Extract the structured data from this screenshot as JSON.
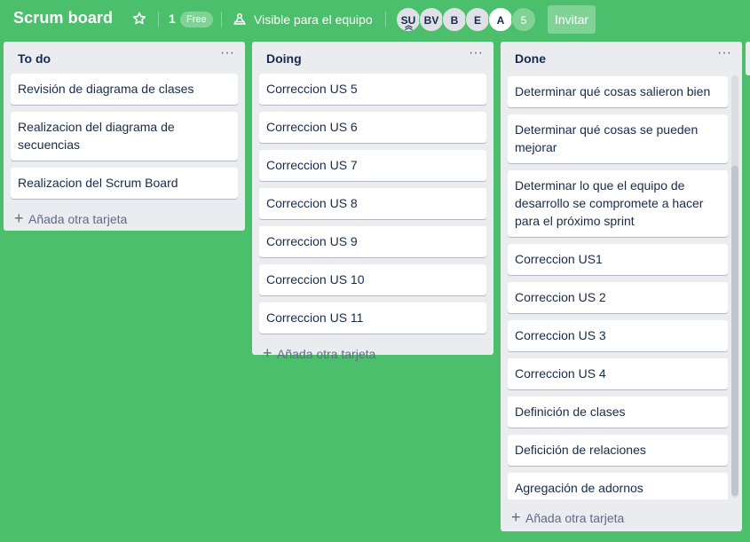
{
  "board": {
    "title": "Scrum board",
    "team_count": "1",
    "plan_badge": "Free",
    "visibility": "Visible para el equipo",
    "invite_label": "Invitar",
    "members": [
      "SU",
      "BV",
      "B",
      "E",
      "A"
    ],
    "more_members": "5",
    "colors": {
      "background": "#4bbf6b",
      "list": "#ebecf0",
      "card": "#ffffff"
    }
  },
  "lists": {
    "todo": {
      "title": "To do",
      "cards": [
        "Revisión de diagrama de clases",
        "Realizacion del diagrama de secuencias",
        "Realizacion del Scrum Board"
      ],
      "add_card": "Añada otra tarjeta"
    },
    "doing": {
      "title": "Doing",
      "cards": [
        "Correccion US 5",
        "Correccion US 6",
        "Correccion US 7",
        "Correccion US 8",
        "Correccion US 9",
        "Correccion US 10",
        "Correccion US 11"
      ],
      "add_card": "Añada otra tarjeta"
    },
    "done": {
      "title": "Done",
      "cards": [
        "Determinar qué cosas salieron bien",
        "Determinar qué cosas se pueden mejorar",
        "Determinar lo que el equipo de desarrollo se compromete a hacer para el próximo sprint",
        "Correccion US1",
        "Correccion US 2",
        "Correccion US 3",
        "Correccion US 4",
        "Definición de clases",
        "Deficición de relaciones",
        "Agregación de adornos"
      ],
      "add_card": "Añada otra tarjeta"
    }
  }
}
